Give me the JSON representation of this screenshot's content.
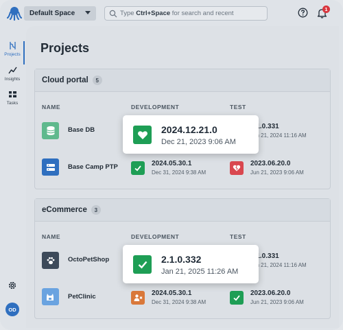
{
  "topbar": {
    "space": "Default Space",
    "search_pre": "Type ",
    "search_keys": "Ctrl+Space",
    "search_post": " for search and recent",
    "notifications": "1"
  },
  "sidebar": {
    "items": [
      {
        "label": "Projects",
        "icon": "projects-icon",
        "active": true
      },
      {
        "label": "Insights",
        "icon": "insights-icon"
      },
      {
        "label": "Tasks",
        "icon": "tasks-icon"
      }
    ],
    "avatar": "OD"
  },
  "page": {
    "title": "Projects"
  },
  "columns": {
    "name": "NAME",
    "dev": "DEVELOPMENT",
    "test": "TEST"
  },
  "groups": [
    {
      "name": "Cloud portal",
      "count": "5",
      "projects": [
        {
          "name": "Base DB",
          "icon": "database-icon",
          "dev": null,
          "test": {
            "version": "2.1.0.331",
            "date": "Jun 21, 2024 11:16 AM",
            "status": "success"
          }
        },
        {
          "name": "Base Camp PTP",
          "icon": "server-icon",
          "dev": {
            "version": "2024.05.30.1",
            "date": "Dec 31, 2024 9:38 AM",
            "status": "success"
          },
          "test": {
            "version": "2023.06.20.0",
            "date": "Jun 21, 2023 9:06 AM",
            "status": "failed"
          }
        }
      ],
      "popup": {
        "version": "2024.12.21.0",
        "date": "Dec 21, 2023 9:06 AM",
        "status": "healthy"
      }
    },
    {
      "name": "eCommerce",
      "count": "3",
      "projects": [
        {
          "name": "OctoPetShop",
          "icon": "paw-icon",
          "dev": null,
          "test": {
            "version": "2.1.0.331",
            "date": "Jun 21, 2024 11:16 AM",
            "status": "success"
          }
        },
        {
          "name": "PetClinic",
          "icon": "cat-icon",
          "dev": {
            "version": "2024.05.30.1",
            "date": "Dec 31, 2024 9:38 AM",
            "status": "cancelled"
          },
          "test": {
            "version": "2023.06.20.0",
            "date": "Jun 21, 2023 9:06 AM",
            "status": "success"
          }
        }
      ],
      "popup": {
        "version": "2.1.0.332",
        "date": "Jan 21, 2025 11:26 AM",
        "status": "success"
      }
    }
  ],
  "colors": {
    "success": "#1e9e55",
    "failed": "#d9474f",
    "cancelled": "#d9783a",
    "accent": "#2f6fbf",
    "notification": "#d9363e"
  }
}
